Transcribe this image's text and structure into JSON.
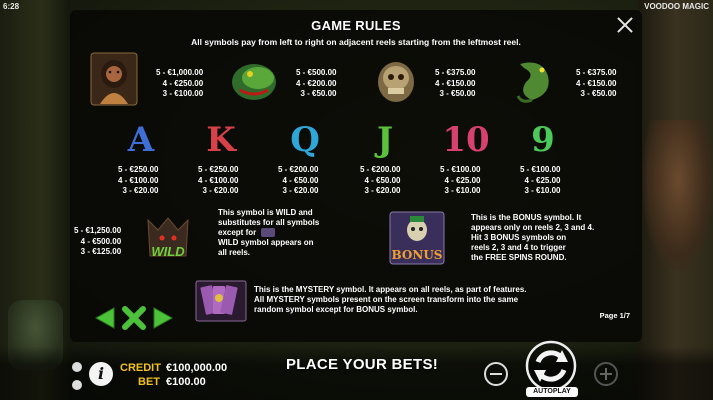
{
  "status": {
    "clock": "6:28",
    "game_logo": "VOODOO MAGIC"
  },
  "rules": {
    "title": "GAME RULES",
    "subtitle": "All symbols pay from left to right on adjacent reels starting from the leftmost reel.",
    "page": "Page 1/7"
  },
  "high_symbols": [
    {
      "icon": "voodoo-woman-icon",
      "pays": [
        "5 - €1,000.00",
        "4 - €250.00",
        "3 - €100.00"
      ]
    },
    {
      "icon": "snake-icon",
      "pays": [
        "5 - €500.00",
        "4 - €200.00",
        "3 - €50.00"
      ]
    },
    {
      "icon": "skull-snake-icon",
      "pays": [
        "5 - €375.00",
        "4 - €150.00",
        "3 - €50.00"
      ]
    },
    {
      "icon": "lizard-icon",
      "pays": [
        "5 - €375.00",
        "4 - €150.00",
        "3 - €50.00"
      ]
    }
  ],
  "low_symbols": [
    {
      "letter": "A",
      "color": "#3f6fd6",
      "pays": [
        "5 - €250.00",
        "4 - €100.00",
        "3 - €20.00"
      ]
    },
    {
      "letter": "K",
      "color": "#d8404a",
      "pays": [
        "5 - €250.00",
        "4 - €100.00",
        "3 - €20.00"
      ]
    },
    {
      "letter": "Q",
      "color": "#2fa6d8",
      "pays": [
        "5 - €200.00",
        "4 - €50.00",
        "3 - €20.00"
      ]
    },
    {
      "letter": "J",
      "color": "#5cc13a",
      "pays": [
        "5 - €200.00",
        "4 - €50.00",
        "3 - €20.00"
      ]
    },
    {
      "letter": "10",
      "color": "#d8406f",
      "pays": [
        "5 - €100.00",
        "4 - €25.00",
        "3 - €10.00"
      ]
    },
    {
      "letter": "9",
      "color": "#4bc95a",
      "pays": [
        "5 - €100.00",
        "4 - €25.00",
        "3 - €10.00"
      ]
    }
  ],
  "wild": {
    "pays": [
      "5 - €1,250.00",
      "4 - €500.00",
      "3 - €125.00"
    ],
    "label": "WILD",
    "text_lines": [
      "This symbol is WILD and",
      "substitutes for all symbols",
      "except for",
      "WILD symbol appears on",
      "all reels."
    ]
  },
  "bonus": {
    "label": "BONUS",
    "text_lines": [
      "This is the BONUS symbol. It",
      "appears only on reels 2, 3 and 4.",
      "Hit 3 BONUS symbols on",
      "reels 2, 3 and 4 to trigger",
      "the FREE SPINS ROUND."
    ]
  },
  "mystery": {
    "text_lines": [
      "This is the MYSTERY symbol. It appears on all reels, as part of features.",
      "All MYSTERY symbols present on the screen transform into the same",
      "random symbol except for BONUS symbol."
    ]
  },
  "bottom": {
    "credit_label": "CREDIT",
    "credit_value": "€100,000.00",
    "bet_label": "BET",
    "bet_value": "€100.00",
    "place_bets": "PLACE YOUR BETS!",
    "autoplay": "AUTOPLAY"
  },
  "colors": {
    "accent_yellow": "#f2c21c",
    "nav_green": "#4cc23a"
  }
}
